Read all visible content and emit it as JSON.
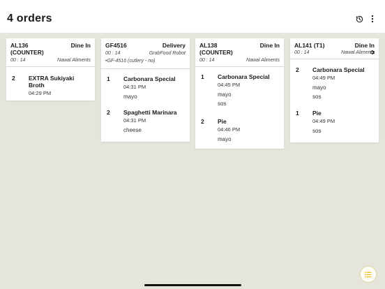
{
  "header": {
    "title": "4 orders",
    "history_icon": "history-icon",
    "more_icon": "more-vertical-icon"
  },
  "orders": [
    {
      "id": "AL136 (COUNTER)",
      "type": "Dine In",
      "timer": "00 : 14",
      "source": "Nawal Aliments",
      "note": "",
      "items": [
        {
          "qty": "2",
          "name": "EXTRA Sukiyaki Broth",
          "time": "04:29 PM",
          "mods": []
        }
      ]
    },
    {
      "id": "GF4516",
      "type": "Delivery",
      "timer": "00 : 14",
      "source": "GrabFood Robot",
      "note": "•GF-4516 (cutlery - no)",
      "items": [
        {
          "qty": "1",
          "name": "Carbonara Special",
          "time": "04:31 PM",
          "mods": [
            "mayo"
          ]
        },
        {
          "qty": "2",
          "name": "Spaghetti Marinara",
          "time": "04:31 PM",
          "mods": [
            "cheese"
          ]
        }
      ]
    },
    {
      "id": "AL138 (COUNTER)",
      "type": "Dine In",
      "timer": "00 : 14",
      "source": "Nawal Aliments",
      "note": "",
      "items": [
        {
          "qty": "1",
          "name": "Carbonara Special",
          "time": "04:45 PM",
          "mods": [
            "mayo",
            "sos"
          ]
        },
        {
          "qty": "2",
          "name": "Pie",
          "time": "04:46 PM",
          "mods": [
            "mayo"
          ]
        }
      ]
    },
    {
      "id": "AL141 (T1)",
      "type": "Dine In",
      "timer": "00 : 14",
      "source": "Nawal Aliments",
      "note": "",
      "items": [
        {
          "qty": "2",
          "name": "Carbonara Special",
          "time": "04:49 PM",
          "mods": [
            "mayo",
            "sos"
          ]
        },
        {
          "qty": "1",
          "name": "Pie",
          "time": "04:49 PM",
          "mods": [
            "sos"
          ]
        }
      ]
    }
  ],
  "fab": {
    "icon": "list-icon",
    "accent": "#f2b705"
  },
  "colors": {
    "background": "#e6e5dc",
    "card": "#ffffff",
    "header": "#ffffff"
  }
}
